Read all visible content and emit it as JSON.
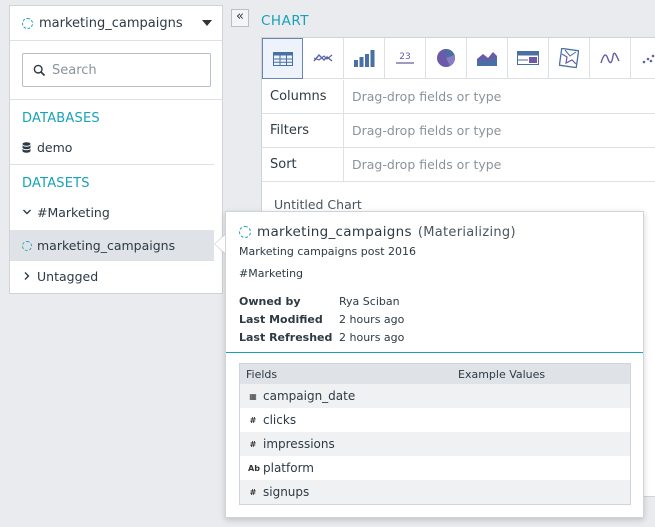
{
  "dataset_picker": {
    "selected": "marketing_campaigns"
  },
  "search": {
    "placeholder": "Search"
  },
  "sidebar": {
    "databases_heading": "DATABASES",
    "databases": [
      {
        "label": "demo",
        "icon": "database-icon"
      }
    ],
    "datasets_heading": "DATASETS",
    "datasets": [
      {
        "label": "#Marketing",
        "icon": "chevron-down-icon"
      },
      {
        "label": "marketing_campaigns",
        "icon": "spinner-icon"
      },
      {
        "label": "Untagged",
        "icon": "chevron-right-icon"
      }
    ]
  },
  "collapse_toggle": "«",
  "chart": {
    "heading": "CHART",
    "types": [
      "table",
      "line",
      "bar",
      "number",
      "pie",
      "area",
      "pivot",
      "map",
      "scatter-line",
      "scatter"
    ],
    "shelves": [
      {
        "name": "Columns",
        "placeholder": "Drag-drop fields or type"
      },
      {
        "name": "Filters",
        "placeholder": "Drag-drop fields or type"
      },
      {
        "name": "Sort",
        "placeholder": "Drag-drop fields or type"
      }
    ],
    "untitled": "Untitled Chart"
  },
  "popover": {
    "title": "marketing_campaigns",
    "status": "(Materializing)",
    "description": "Marketing campaigns post 2016",
    "tag": "#Marketing",
    "meta": [
      {
        "label": "Owned by",
        "value": "Rya Sciban"
      },
      {
        "label": "Last Modified",
        "value": "2 hours ago"
      },
      {
        "label": "Last Refreshed",
        "value": "2 hours ago"
      }
    ],
    "fields_header": "Fields",
    "examples_header": "Example Values",
    "fields": [
      {
        "name": "campaign_date",
        "type": "date",
        "glyph": "▦"
      },
      {
        "name": "clicks",
        "type": "number",
        "glyph": "#"
      },
      {
        "name": "impressions",
        "type": "number",
        "glyph": "#"
      },
      {
        "name": "platform",
        "type": "text",
        "glyph": "Ab"
      },
      {
        "name": "signups",
        "type": "number",
        "glyph": "#"
      }
    ]
  },
  "colors": {
    "accent": "#17a2b8",
    "selected_row": "#dfe3e8",
    "chart_icon": "#6a5aa8"
  }
}
